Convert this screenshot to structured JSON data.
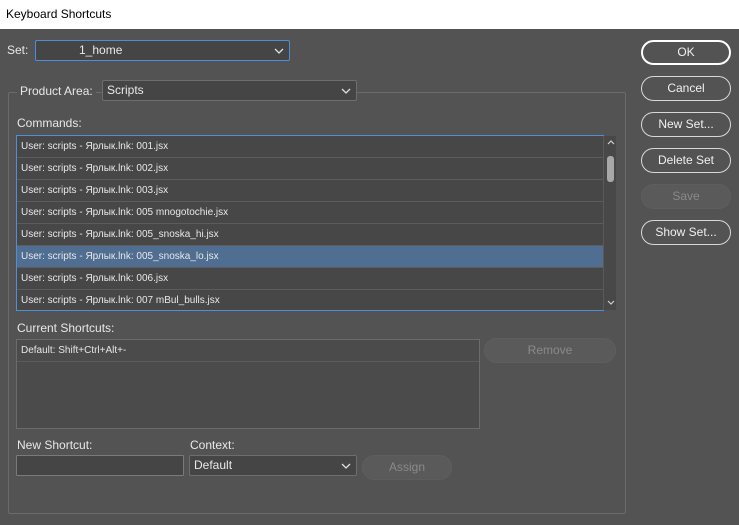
{
  "window": {
    "title": "Keyboard Shortcuts"
  },
  "set": {
    "label": "Set:",
    "value": "1_home"
  },
  "product_area": {
    "label": "Product Area:",
    "value": "Scripts"
  },
  "commands": {
    "label": "Commands:",
    "items": [
      "User: scripts - Ярлык.lnk: 001.jsx",
      "User: scripts - Ярлык.lnk: 002.jsx",
      "User: scripts - Ярлык.lnk: 003.jsx",
      "User: scripts - Ярлык.lnk: 005 mnogotochie.jsx",
      "User: scripts - Ярлык.lnk: 005_snoska_hi.jsx",
      "User: scripts - Ярлык.lnk: 005_snoska_lo.jsx",
      "User: scripts - Ярлык.lnk: 006.jsx",
      "User: scripts - Ярлык.lnk: 007 mBul_bulls.jsx"
    ],
    "selected_index": 5
  },
  "current_shortcuts": {
    "label": "Current Shortcuts:",
    "items": [
      "Default: Shift+Ctrl+Alt+-"
    ],
    "remove_label": "Remove"
  },
  "new_shortcut": {
    "label": "New Shortcut:",
    "value": ""
  },
  "context": {
    "label": "Context:",
    "value": "Default"
  },
  "assign_label": "Assign",
  "buttons": {
    "ok": "OK",
    "cancel": "Cancel",
    "new_set": "New Set...",
    "delete_set": "Delete Set",
    "save": "Save",
    "show_set": "Show Set..."
  },
  "colors": {
    "dialog_bg": "#535353",
    "list_bg": "#474747",
    "selection": "#4f6e91",
    "focus_border": "#4f8fd6"
  }
}
